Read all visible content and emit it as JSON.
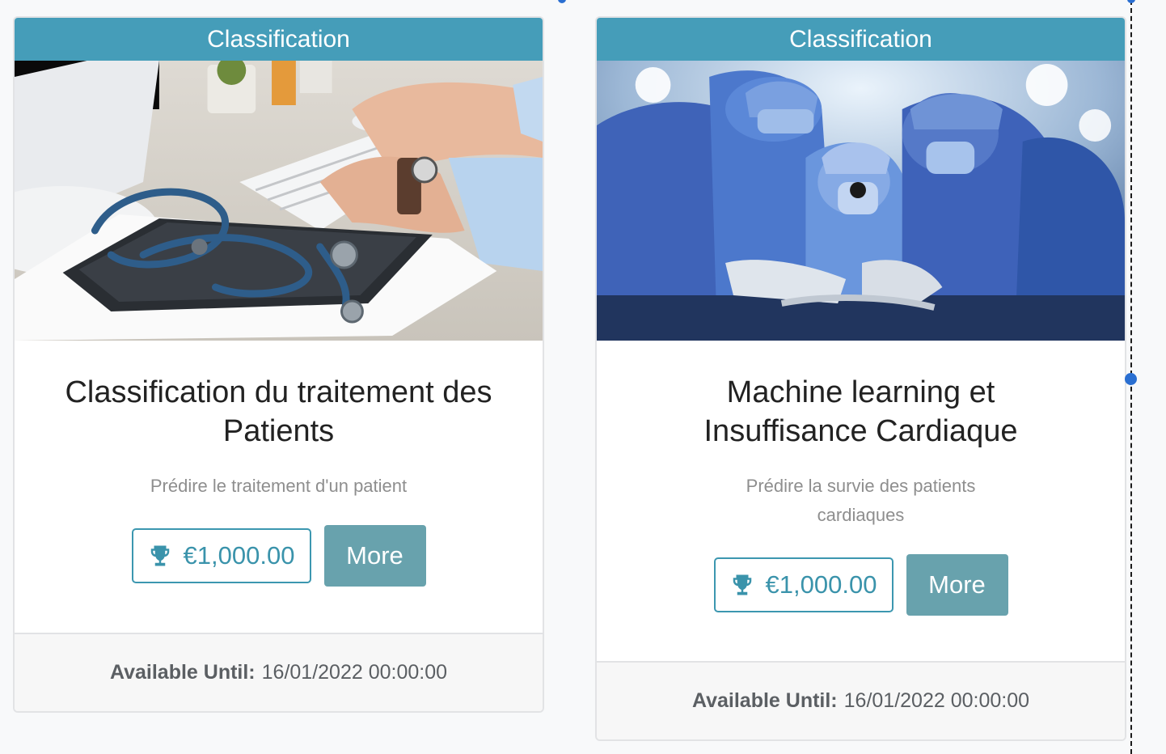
{
  "cards": [
    {
      "category": "Classification",
      "title": "Classification du traitement des Patients",
      "subtitle": "Prédire le traitement d'un patient",
      "prize": "€1,000.00",
      "more_label": "More",
      "available_label": "Available Until:",
      "available_value": "16/01/2022 00:00:00"
    },
    {
      "category": "Classification",
      "title": "Machine learning et Insuffisance Cardiaque",
      "subtitle": "Prédire la survie des patients cardiaques",
      "prize": "€1,000.00",
      "more_label": "More",
      "available_label": "Available Until:",
      "available_value": "16/01/2022 00:00:00"
    }
  ],
  "icons": {
    "prize": "trophy-icon"
  },
  "colors": {
    "ribbon": "#459db9",
    "button": "#68a2ad",
    "prize_border": "#3c97b0"
  }
}
